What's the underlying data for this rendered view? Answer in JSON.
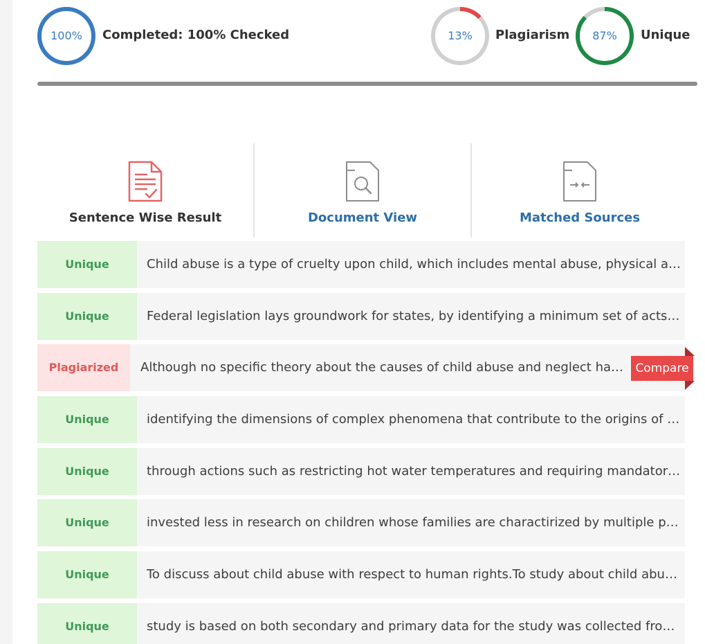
{
  "progress": {
    "completed": {
      "percent_text": "100%",
      "fraction": 1.0,
      "label": "Completed: 100% Checked",
      "color": "#3a7cc0"
    },
    "plagiarism": {
      "percent_text": "13%",
      "fraction": 0.13,
      "label": "Plagiarism",
      "color": "#e04a4a"
    },
    "unique": {
      "percent_text": "87%",
      "fraction": 0.87,
      "label": "Unique",
      "color": "#1f8a46"
    }
  },
  "tabs": [
    {
      "label": "Sentence Wise Result",
      "icon": "report-check-icon",
      "active": true
    },
    {
      "label": "Document View",
      "icon": "document-search-icon",
      "active": false
    },
    {
      "label": "Matched Sources",
      "icon": "document-compare-icon",
      "active": false
    }
  ],
  "rows": [
    {
      "status": "Unique",
      "text": "Child abuse is a type of cruelty upon child, which includes mental abuse, physical abuse"
    },
    {
      "status": "Unique",
      "text": "Federal legislation lays groundwork for states, by identifying a minimum set of acts or behaviors"
    },
    {
      "status": "Plagiarized",
      "text": "Although no specific theory about the causes of child abuse and neglect has been",
      "action": "Compare"
    },
    {
      "status": "Unique",
      "text": "identifying the dimensions of complex phenomena that contribute to the origins of child abuse"
    },
    {
      "status": "Unique",
      "text": "through actions such as restricting hot water temperatures and requiring mandatory reporting"
    },
    {
      "status": "Unique",
      "text": "invested less in research on children whose families are charactirized by multiple problems"
    },
    {
      "status": "Unique",
      "text": "To discuss about child abuse with respect to human rights.To study about child abuse laws"
    },
    {
      "status": "Unique",
      "text": "study is based on both secondary and primary data for the study was collected from the field"
    }
  ],
  "colors": {
    "unique_bg": "#dff6d9",
    "unique_text": "#3f9a57",
    "plagiarized_bg": "#fde3e3",
    "plagiarized_text": "#e0595a",
    "compare_button": "#e94848",
    "link": "#2e6ea8"
  }
}
